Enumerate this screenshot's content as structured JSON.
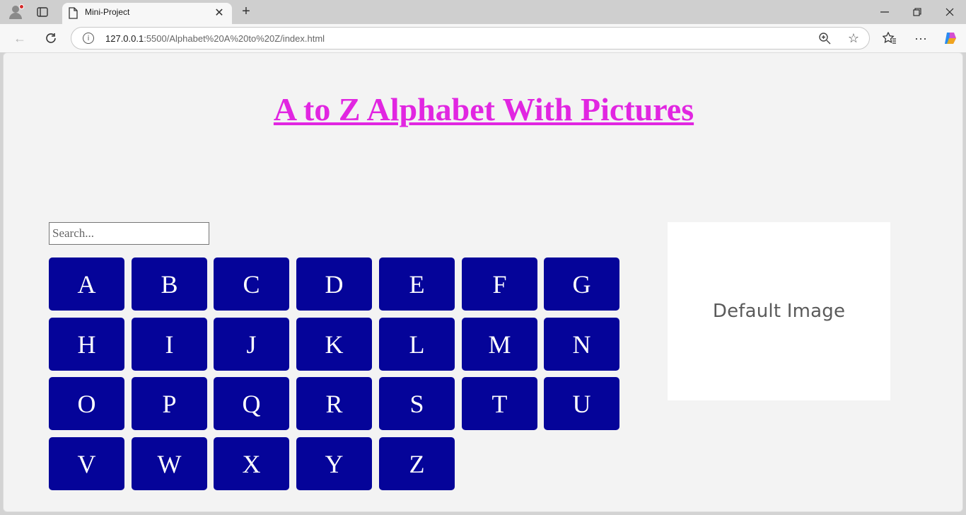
{
  "browser": {
    "tab_title": "Mini-Project",
    "url_host": "127.0.0.1",
    "url_rest": ":5500/Alphabet%20A%20to%20Z/index.html"
  },
  "page": {
    "heading": "A to Z Alphabet With Pictures",
    "search_placeholder": "Search...",
    "letters": [
      "A",
      "B",
      "C",
      "D",
      "E",
      "F",
      "G",
      "H",
      "I",
      "J",
      "K",
      "L",
      "M",
      "N",
      "O",
      "P",
      "Q",
      "R",
      "S",
      "T",
      "U",
      "V",
      "W",
      "X",
      "Y",
      "Z"
    ],
    "preview_text": "Default Image"
  },
  "colors": {
    "heading": "#e126e1",
    "button": "#050499",
    "page_bg": "#f3f3f3"
  }
}
